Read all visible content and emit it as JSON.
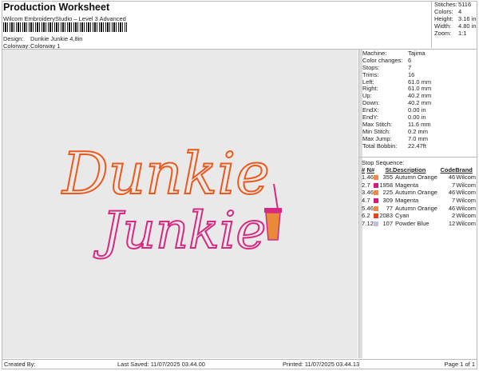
{
  "header": {
    "title": "Production Worksheet",
    "subtitle": "Wilcom EmbroideryStudio – Level 3 Advanced",
    "design_label": "Design:",
    "design_value": "Dunkie Junkie 4,8in",
    "colorway_label": "Colorway:",
    "colorway_value": "Colorway 1"
  },
  "summary": [
    {
      "k": "Stitches:",
      "v": "5116"
    },
    {
      "k": "Colors:",
      "v": "4"
    },
    {
      "k": "Height:",
      "v": "3.16 in"
    },
    {
      "k": "Width:",
      "v": "4.80 in"
    },
    {
      "k": "Zoom:",
      "v": "1:1"
    }
  ],
  "machine": [
    {
      "k": "Machine:",
      "v": "Tajima"
    },
    {
      "k": "Color changes:",
      "v": "6"
    },
    {
      "k": "Stops:",
      "v": "7"
    },
    {
      "k": "Trims:",
      "v": "16"
    },
    {
      "k": "Left:",
      "v": "61.0 mm"
    },
    {
      "k": "Right:",
      "v": "61.0 mm"
    },
    {
      "k": "Up:",
      "v": "40.2 mm"
    },
    {
      "k": "Down:",
      "v": "40.2 mm"
    },
    {
      "k": "EndX:",
      "v": "0.00 in"
    },
    {
      "k": "EndY:",
      "v": "0.00 in"
    },
    {
      "k": "Max Stitch:",
      "v": "11.6 mm"
    },
    {
      "k": "Min Stitch:",
      "v": "0.2 mm"
    },
    {
      "k": "Max Jump:",
      "v": "7.0 mm"
    },
    {
      "k": "Total Bobbin:",
      "v": "22.47ft"
    }
  ],
  "stop_sequence": {
    "title": "Stop Sequence:",
    "headers": [
      "#",
      "N#",
      "St.",
      "Description",
      "Code",
      "Brand"
    ],
    "rows": [
      {
        "i": "1.",
        "n": "46",
        "color": "#f08a4b",
        "st": "355",
        "desc": "Autumn Orange",
        "code": "46",
        "brand": "Wilcom"
      },
      {
        "i": "2.",
        "n": "7",
        "color": "#d81b7a",
        "st": "1958",
        "desc": "Magenta",
        "code": "7",
        "brand": "Wilcom"
      },
      {
        "i": "3.",
        "n": "46",
        "color": "#f08a4b",
        "st": "225",
        "desc": "Autumn Orange",
        "code": "46",
        "brand": "Wilcom"
      },
      {
        "i": "4.",
        "n": "7",
        "color": "#d81b7a",
        "st": "309",
        "desc": "Magenta",
        "code": "7",
        "brand": "Wilcom"
      },
      {
        "i": "5.",
        "n": "46",
        "color": "#f08a4b",
        "st": "77",
        "desc": "Autumn Orange",
        "code": "46",
        "brand": "Wilcom"
      },
      {
        "i": "6.",
        "n": "2",
        "color": "#f0401a",
        "st": "2083",
        "desc": "Cyan",
        "code": "2",
        "brand": "Wilcom"
      },
      {
        "i": "7.",
        "n": "12",
        "color": "#c4c0dc",
        "st": "107",
        "desc": "Powder Blue",
        "code": "12",
        "brand": "Wilcom"
      }
    ]
  },
  "artwork": {
    "line1": "Dunkie",
    "line2": "Junkie",
    "color1": "#ea5a1c",
    "color2": "#d62a82"
  },
  "footer": {
    "created": "Created By:",
    "saved": "Last Saved: 11/07/2025 03.44.00",
    "printed": "Printed: 11/07/2025 03.44.13",
    "page": "Page 1 of 1"
  }
}
